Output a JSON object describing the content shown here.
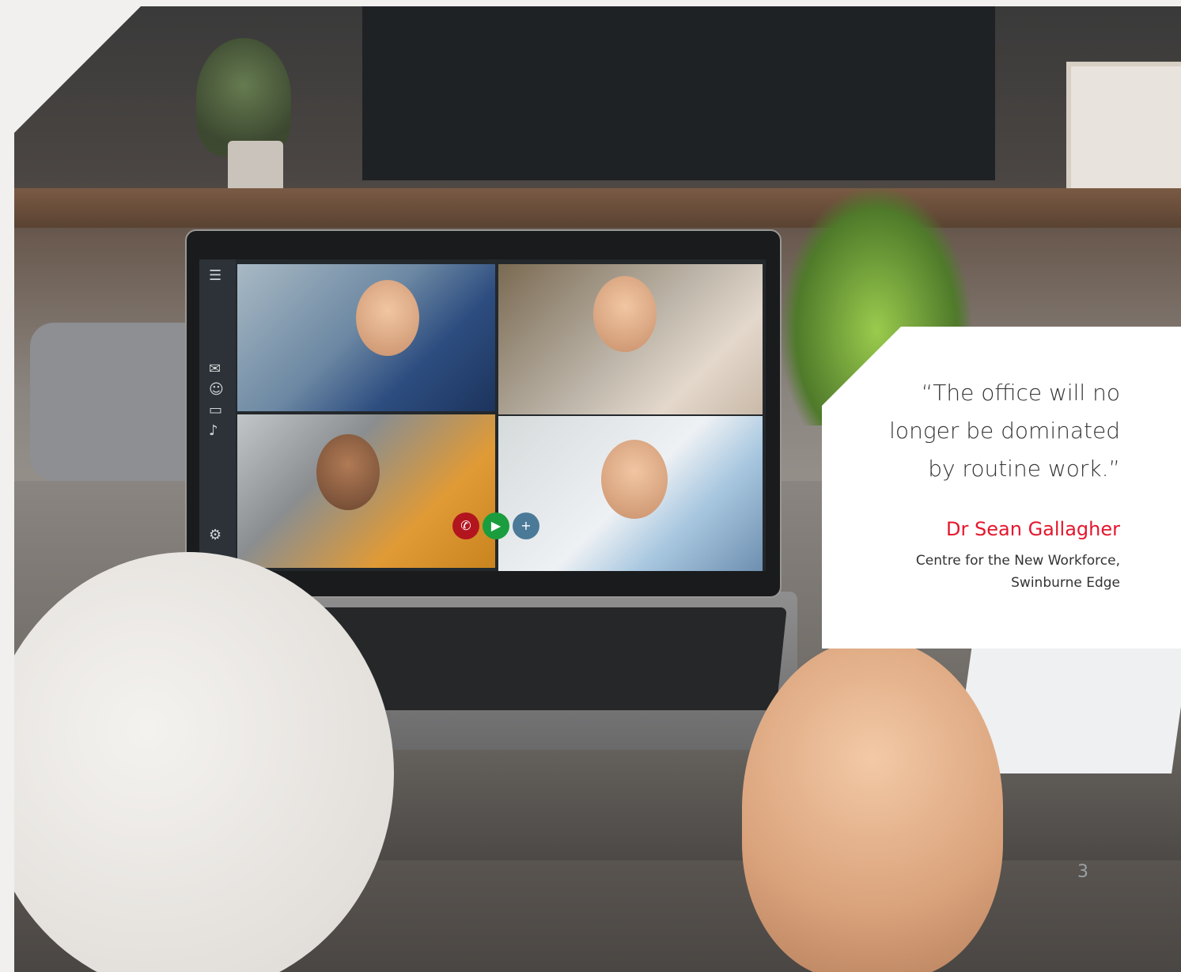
{
  "quote": {
    "line1": "“The office will no",
    "line2": "longer be dominated",
    "line3": "by routine work.”",
    "author": "Dr Sean Gallagher",
    "affiliation_line1": "Centre for the New Workforce,",
    "affiliation_line2": "Swinburne Edge"
  },
  "page_number": "3",
  "colors": {
    "accent": "#e5162d",
    "text": "#333333",
    "page_bg": "#f1f0ee"
  },
  "video_call": {
    "sidebar_icons": [
      "menu-icon",
      "mail-icon",
      "contact-icon",
      "chat-icon",
      "microphone-icon",
      "settings-icon"
    ],
    "call_controls": [
      "end-call-icon",
      "video-camera-icon",
      "add-participant-icon"
    ]
  }
}
